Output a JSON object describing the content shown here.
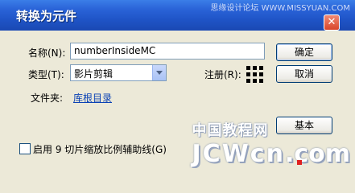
{
  "window": {
    "title": "转换为元件",
    "close_label": "✕"
  },
  "watermark_top": "思缘设计论坛  WWW.MISSYUAN.COM",
  "form": {
    "name_label": "名称(N):",
    "name_value": "numberInsideMC",
    "type_label": "类型(T):",
    "type_value": "影片剪辑",
    "registration_label": "注册(R):",
    "folder_label": "文件夹:",
    "folder_link": "库根目录",
    "nine_slice_label": "启用 9 切片缩放比例辅助线(G)",
    "nine_slice_checked": false
  },
  "buttons": {
    "ok": "确定",
    "cancel": "取消",
    "basic": "基本"
  },
  "brand": {
    "cn": "中国教程网",
    "en": "JCWcn",
    "tld": ".com"
  },
  "colors": {
    "titlebar": "#2a63d8",
    "dialog_bg": "#ece9d8",
    "link": "#0b42b5",
    "red_marker": "#e02020"
  }
}
